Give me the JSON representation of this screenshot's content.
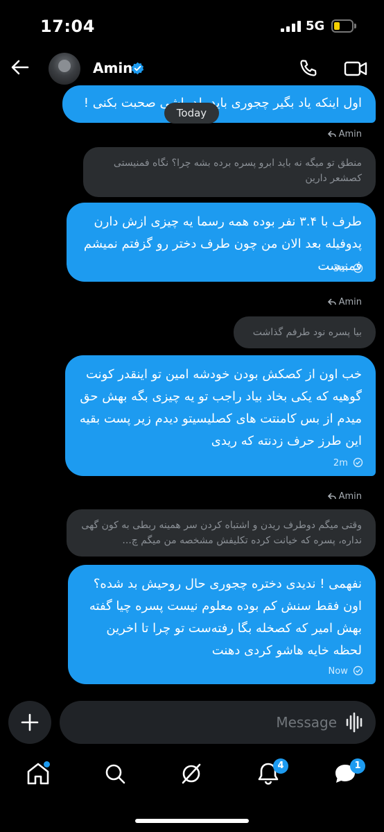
{
  "status_bar": {
    "time": "17:04",
    "network": "5G"
  },
  "header": {
    "contact_name": "Amin"
  },
  "today_label": "Today",
  "messages": [
    {
      "kind": "sent",
      "text": "اول اینکه یاد بگیر چجوری باید بلد باشی صحبت بکنی !"
    },
    {
      "kind": "reply_tag",
      "label": "Amin"
    },
    {
      "kind": "quoted",
      "text": "منطق تو میگه نه باید ابرو پسره برده بشه چرا؟ نگاه فمنیستی کصشعر دارین"
    },
    {
      "kind": "sent",
      "text": "طرف با ۳.۴ نفر بوده همه رسما یه چیزی ازش دارن پدوفیله بعد الان من چون طرف دختر رو گزفتم نمیشم فمنیست",
      "time": "3m"
    },
    {
      "kind": "reply_tag",
      "label": "Amin"
    },
    {
      "kind": "quoted",
      "text": "بیا پسره نود طرفم گذاشت"
    },
    {
      "kind": "sent",
      "text": "خب اون از کصکش بودن خودشه امین تو اینقدر کونت گوهیه که یکی بخاد بیاد راجب تو یه چیزی بگه بهش حق میدم از بس کامنتت های کصلیسیتو دیدم زیر پست بقیه این طرز حرف زدنته که ریدی",
      "time": "2m"
    },
    {
      "kind": "reply_tag",
      "label": "Amin"
    },
    {
      "kind": "quoted",
      "text": "وقتی میگم دوطرف ریدن و اشتباه کردن سر همینه ربطی به کون گهی نداره، پسره که خیانت کرده تکلیفش مشخصه من میگم چ..."
    },
    {
      "kind": "sent",
      "text": "نفهمی ! ندیدی دختره چجوری حال روحیش بد شده؟ اون فقط سنش کم بوده معلوم نیست پسره چیا گفته بهش امیر که کصخله بگا رفته‌ست تو چرا تا اخرین لحظه خایه هاشو کردی دهنت",
      "time": "Now"
    }
  ],
  "composer": {
    "placeholder": "Message"
  },
  "nav": {
    "notifications_badge": "4",
    "messages_badge": "1"
  },
  "colors": {
    "accent": "#1d9bf0",
    "quote_bg": "#2a2d30",
    "background": "#000000"
  },
  "icons": [
    "back-arrow-icon",
    "verified-badge-icon",
    "phone-icon",
    "video-camera-icon",
    "reply-arrow-icon",
    "read-check-icon",
    "plus-icon",
    "voice-wave-icon",
    "home-icon",
    "search-icon",
    "grok-icon",
    "bell-icon",
    "messages-icon"
  ]
}
